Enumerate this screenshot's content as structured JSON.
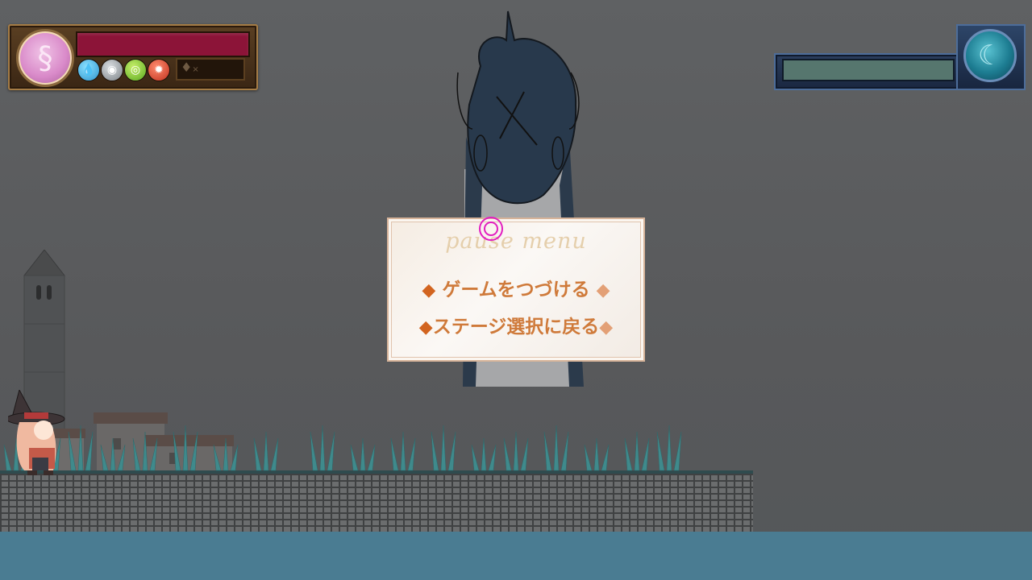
{
  "player_hud": {
    "portrait_icon": "swirl-emblem",
    "hp_color": "#8c1438",
    "elements": [
      {
        "name": "water",
        "icon": "water-drop-icon",
        "glyph": "💧"
      },
      {
        "name": "wind",
        "icon": "wind-orb-icon",
        "glyph": "◉"
      },
      {
        "name": "leaf",
        "icon": "leaf-swirl-icon",
        "glyph": "◎"
      },
      {
        "name": "fire",
        "icon": "maple-leaf-icon",
        "glyph": "✹"
      }
    ],
    "item_slot": {
      "glyph": "♦",
      "count_prefix": "×"
    }
  },
  "boss_hud": {
    "hp_color": "#56766e",
    "portrait_icon": "moon-swirl-emblem"
  },
  "pause_menu": {
    "title": "pause menu",
    "options": [
      {
        "label": "ゲームをつづける",
        "selected": true
      },
      {
        "label": "ステージ選択に戻る",
        "selected": false
      }
    ],
    "marker": "◆"
  },
  "colors": {
    "sky": "#5c5e60",
    "water": "#4a7c92",
    "accent_orange": "#d2641f",
    "cursor_magenta": "#e21fc0"
  }
}
